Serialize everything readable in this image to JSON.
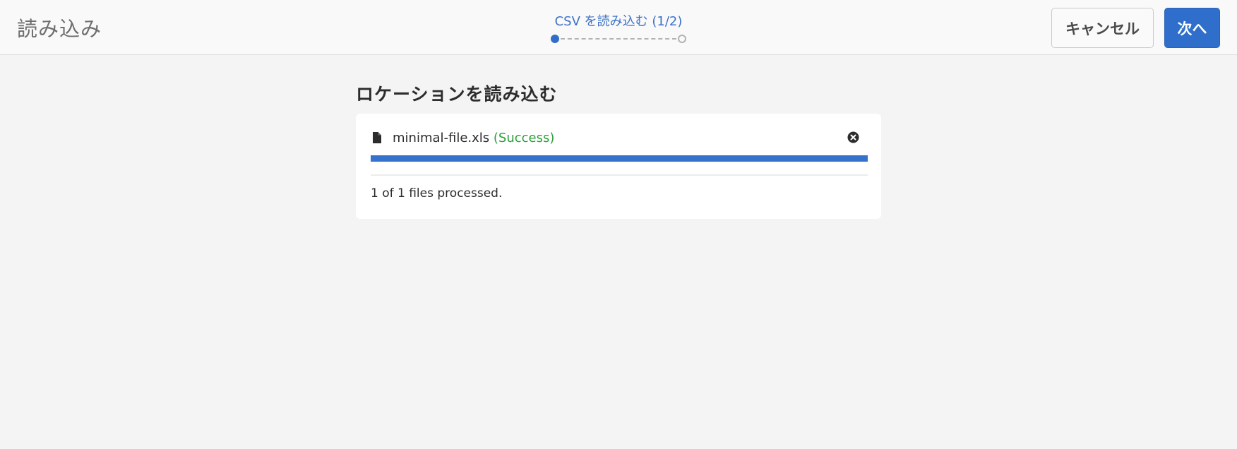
{
  "header": {
    "app_title": "読み込み",
    "wizard": {
      "step_label": "CSV を読み込む (1/2)",
      "current_step": 1,
      "total_steps": 2
    },
    "cancel_label": "キャンセル",
    "next_label": "次へ"
  },
  "main": {
    "heading": "ロケーションを読み込む",
    "upload": {
      "file_name": "minimal-file.xls",
      "status_text": "(Success)",
      "progress_percent": 100,
      "summary": "1 of 1 files processed."
    }
  },
  "colors": {
    "accent": "#326ec8",
    "success": "#2d9d3a",
    "progress": "#3472cc"
  },
  "icons": {
    "file": "file-icon",
    "remove": "close-circle-icon"
  }
}
